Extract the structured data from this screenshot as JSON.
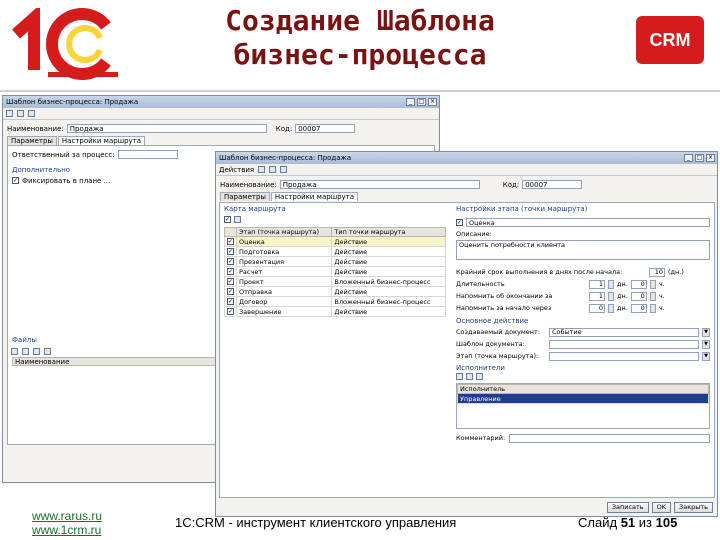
{
  "header": {
    "logo_text": "1С",
    "title_line1": "Создание Шаблона",
    "title_line2": "бизнес-процесса",
    "badge": "CRM",
    "colors": {
      "title": "#7a1212",
      "badge": "#d51c1c",
      "logo": "#d51c1c"
    }
  },
  "back_window": {
    "title": "Шаблон бизнес-процесса: Продажа",
    "name_label": "Наименование:",
    "name_value": "Продажа",
    "code_label": "Код:",
    "code_value": "00007",
    "tabs": [
      "Параметры",
      "Настройки маршрута"
    ],
    "responsible_label": "Ответственный за процесс:",
    "additional_label": "Дополнительно",
    "checkbox1": "Фиксировать в плане ...",
    "files_label": "Файлы",
    "name_col": "Наименование"
  },
  "front_window": {
    "title": "Шаблон бизнес-процесса: Продажа",
    "actions_label": "Действия",
    "name_label": "Наименование:",
    "name_value": "Продажа",
    "code_label": "Код:",
    "code_value": "00007",
    "tabs": [
      "Параметры",
      "Настройки маршрута"
    ],
    "route_map_label": "Карта маршрута",
    "stage_settings_label": "Настройки этапа (точки маршрута)",
    "grid_headers": [
      "Этап (точка маршрута)",
      "Тип точки маршрута"
    ],
    "stages": [
      {
        "stage": "Оценка",
        "type": "Действие"
      },
      {
        "stage": "Подготовка",
        "type": "Действие"
      },
      {
        "stage": "Презентация",
        "type": "Действие"
      },
      {
        "stage": "Расчет",
        "type": "Действие"
      },
      {
        "stage": "Проект",
        "type": "Вложенный бизнес-процесс"
      },
      {
        "stage": "Отправка",
        "type": "Действие"
      },
      {
        "stage": "Договор",
        "type": "Вложенный бизнес-процесс"
      },
      {
        "stage": "Завершение",
        "type": "Действие"
      }
    ],
    "stage_name_value": "Оценка",
    "description_label": "Описание:",
    "description_value": "Оценить потребности клиента",
    "deadline_label": "Крайний срок выполнения в днях после начала:",
    "deadline_value": "10",
    "deadline_unit": "(дн.)",
    "duration_label": "Длительность",
    "remind_label": "Напомнить об окончании за",
    "remind2_label": "Напомнить за начало через",
    "days_unit": "дн.",
    "hours_unit": "ч.",
    "val_1": "1",
    "val_0": "0",
    "main_action_label": "Основное действие",
    "create_doc_label": "Создаваемый документ:",
    "create_doc_value": "Событие",
    "template_label": "Шаблон документа:",
    "executor_label": "Этап (точка маршрута):",
    "executors_label": "Исполнители",
    "exec_headers": [
      "Исполнитель"
    ],
    "executors": [
      "Управление"
    ],
    "comment_label": "Комментарий:",
    "btn_write": "Записать",
    "btn_ok": "OK",
    "btn_close": "Закрыть"
  },
  "footer": {
    "site1": "www.rarus.ru",
    "site2": "www.1crm.ru",
    "center": "1С:CRM - инструмент клиентского управления",
    "slide_prefix": "Слайд",
    "slide_num": "51",
    "slide_of": "из",
    "slide_total": "105"
  }
}
